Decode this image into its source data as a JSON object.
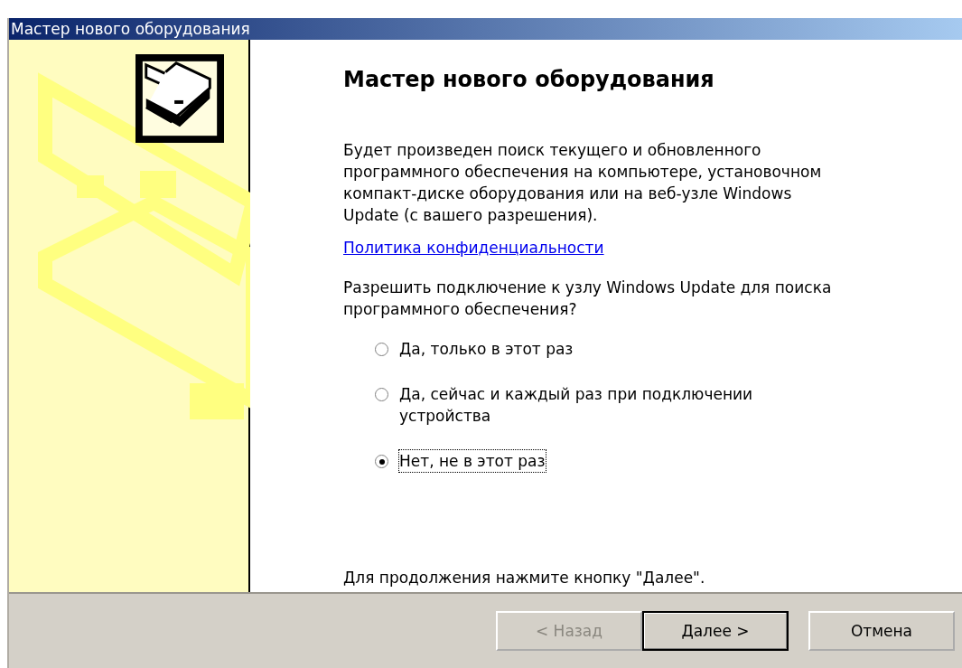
{
  "window": {
    "title": "Мастер нового оборудования"
  },
  "heading": "Мастер нового оборудования",
  "intro": "Будет произведен поиск текущего и обновленного программного обеспечения на компьютере, установочном компакт-диске оборудования или на веб-узле Windows Update (с вашего разрешения).",
  "privacy_link": "Политика конфиденциальности",
  "question": "Разрешить подключение к узлу Windows Update для поиска программного обеспечения?",
  "options": [
    {
      "label": "Да, только в этот раз",
      "selected": false
    },
    {
      "label": "Да, сейчас и каждый раз при подключении устройства",
      "selected": false
    },
    {
      "label": "Нет, не в этот раз",
      "selected": true
    }
  ],
  "footer_hint": "Для продолжения нажмите кнопку \"Далее\".",
  "buttons": [
    {
      "label": "< Назад",
      "disabled": true,
      "default": false
    },
    {
      "label": "Далее >",
      "disabled": false,
      "default": true
    },
    {
      "label": "Отмена",
      "disabled": false,
      "default": false
    }
  ]
}
